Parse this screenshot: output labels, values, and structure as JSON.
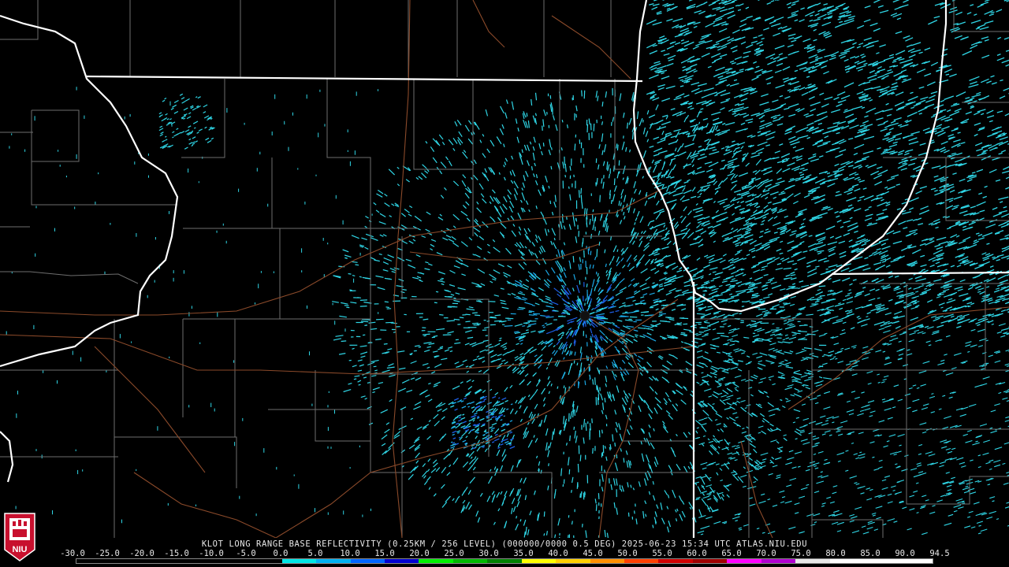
{
  "product_caption": "KLOT LONG RANGE BASE REFLECTIVITY (0.25KM / 256 LEVEL) (000000/0000 0.5 DEG) 2025-06-23 15:34 UTC  ATLAS.NIU.EDU",
  "legend": {
    "ticks": [
      "-30.0",
      "-25.0",
      "-20.0",
      "-15.0",
      "-10.0",
      "-5.0",
      "0.0",
      "5.0",
      "10.0",
      "15.0",
      "20.0",
      "25.0",
      "30.0",
      "35.0",
      "40.0",
      "45.0",
      "50.0",
      "55.0",
      "60.0",
      "65.0",
      "70.0",
      "75.0",
      "80.0",
      "85.0",
      "90.0",
      "94.5"
    ],
    "colors": [
      "#000000",
      "#000000",
      "#000000",
      "#000000",
      "#000000",
      "#000000",
      "#00e5e5",
      "#00b0f0",
      "#0066ff",
      "#0000d0",
      "#00ee00",
      "#00b800",
      "#008000",
      "#ffff00",
      "#ffd000",
      "#ff9000",
      "#ff4000",
      "#d00000",
      "#a00000",
      "#ff00ff",
      "#b000d0",
      "#e8e8e8",
      "#ffffff",
      "#ffffff",
      "#ffffff"
    ]
  },
  "logo_text": "NIU",
  "colors": {
    "background": "#000000",
    "state_border": "#ffffff",
    "county_line": "#6e6e6e",
    "road": "#8b4a2a",
    "echo_light": "#2fd6e6",
    "echo_mid": "#1aa8e6",
    "echo_heavy": "#1e60e8",
    "radar_site": "#111111"
  }
}
